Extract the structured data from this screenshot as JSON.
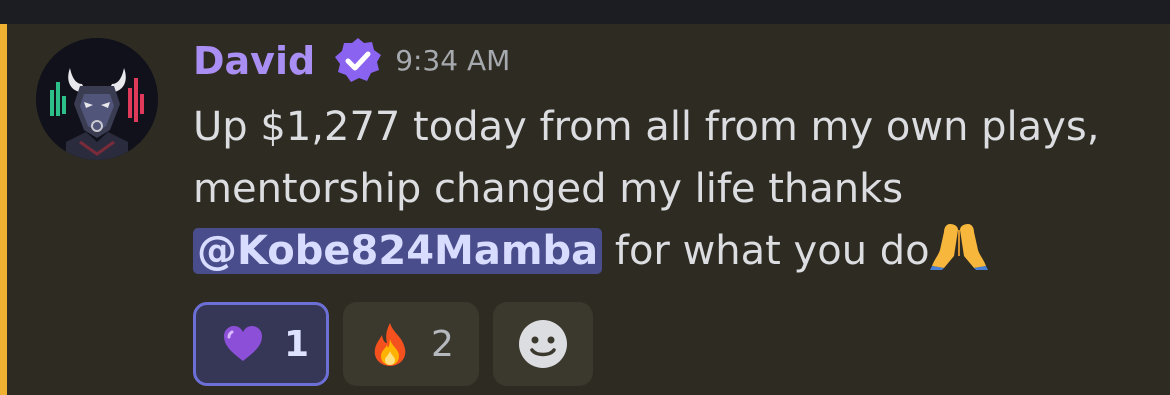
{
  "message": {
    "author": "David",
    "timestamp": "9:34 AM",
    "text_line1": "Up $1,277 today from all from my own plays,",
    "text_line2": "mentorship changed my life thanks",
    "mention": "@Kobe824Mamba",
    "text_line3_after": " for what you do",
    "icons": {
      "avatar": "bull-avatar-icon",
      "badge": "verified-badge-icon",
      "trailing_emoji": "folded-hands-icon"
    }
  },
  "reactions": [
    {
      "emoji": "purple-heart-icon",
      "count": "1",
      "active": true
    },
    {
      "emoji": "fire-icon",
      "count": "2",
      "active": false
    },
    {
      "emoji": "add-reaction-icon",
      "count": "",
      "active": false
    }
  ],
  "colors": {
    "username": "#a98ff4",
    "highlight_bar": "#f0b132",
    "mention_bg": "#4a4d8c",
    "background": "#2e2b22"
  }
}
